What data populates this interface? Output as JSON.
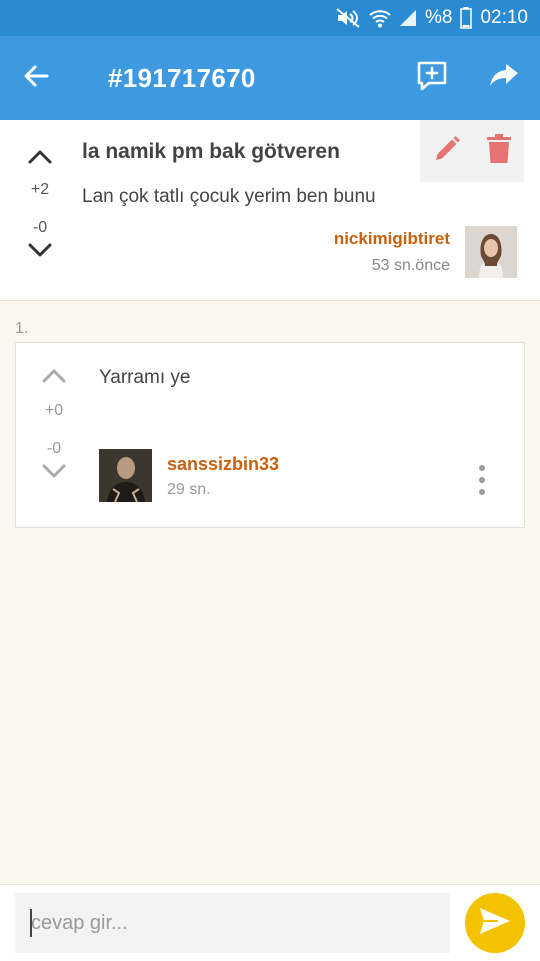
{
  "status_bar": {
    "battery": "%8",
    "time": "02:10"
  },
  "app_bar": {
    "title": "#191717670"
  },
  "post": {
    "title": "la namik pm bak götveren",
    "body": "Lan çok tatlı çocuk yerim ben bunu",
    "upvotes": "+2",
    "downvotes": "-0",
    "author": "nickimigibtiret",
    "time": "53 sn.önce"
  },
  "comments": [
    {
      "index": "1.",
      "text": "Yarramı ye",
      "upvotes": "+0",
      "downvotes": "-0",
      "author": "sanssizbin33",
      "time": "29 sn."
    }
  ],
  "reply": {
    "placeholder": "cevap gir...",
    "value": ""
  },
  "colors": {
    "appbar": "#3d9ae0",
    "statusbar": "#2b8bd2",
    "author": "#c9600c",
    "action_icons": "#e57373",
    "send_button": "#f4c300",
    "background": "#faf7ef"
  },
  "icons": [
    "mute-icon",
    "wifi-icon",
    "signal-icon",
    "battery-icon",
    "back-arrow-icon",
    "add-comment-icon",
    "share-icon",
    "upvote-icon",
    "downvote-icon",
    "edit-icon",
    "delete-icon",
    "more-vert-icon",
    "send-icon"
  ]
}
